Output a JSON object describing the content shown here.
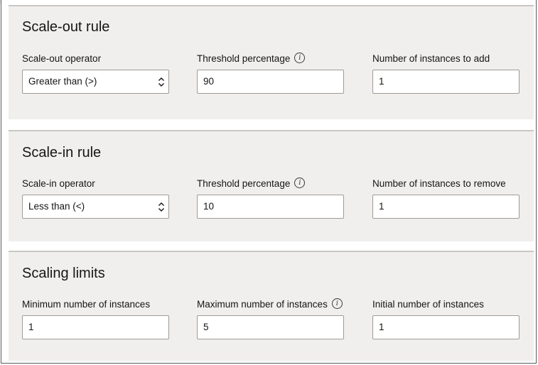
{
  "scale_out": {
    "title": "Scale-out rule",
    "operator_label": "Scale-out operator",
    "operator_value": "Greater than (>)",
    "threshold_label": "Threshold percentage",
    "threshold_value": "90",
    "instances_label": "Number of instances to add",
    "instances_value": "1"
  },
  "scale_in": {
    "title": "Scale-in rule",
    "operator_label": "Scale-in operator",
    "operator_value": "Less than (<)",
    "threshold_label": "Threshold percentage",
    "threshold_value": "10",
    "instances_label": "Number of instances to remove",
    "instances_value": "1"
  },
  "limits": {
    "title": "Scaling limits",
    "min_label": "Minimum number of instances",
    "min_value": "1",
    "max_label": "Maximum number of instances",
    "max_value": "5",
    "initial_label": "Initial number of instances",
    "initial_value": "1"
  },
  "icons": {
    "info": "i"
  }
}
